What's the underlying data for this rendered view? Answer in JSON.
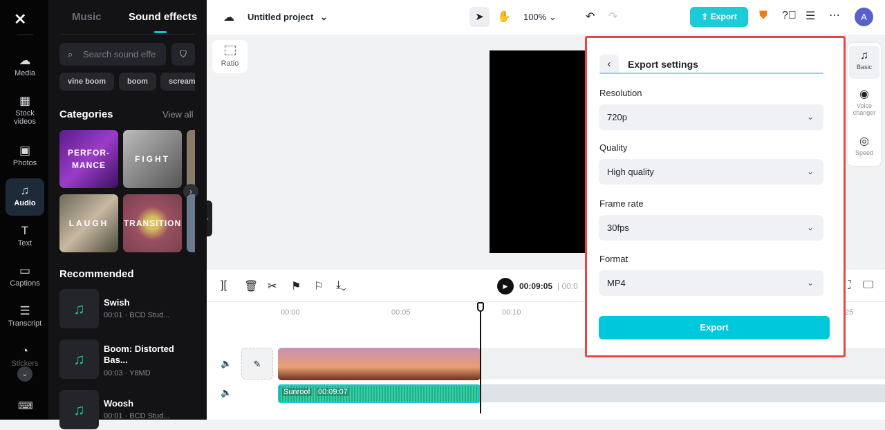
{
  "rail": {
    "items": [
      {
        "label": "Media",
        "icon": "cloud-upload-icon"
      },
      {
        "label": "Stock videos",
        "icon": "film-icon"
      },
      {
        "label": "Photos",
        "icon": "image-icon"
      },
      {
        "label": "Audio",
        "icon": "music-icon",
        "active": true
      },
      {
        "label": "Text",
        "icon": "text-icon"
      },
      {
        "label": "Captions",
        "icon": "captions-icon"
      },
      {
        "label": "Transcript",
        "icon": "transcript-icon"
      },
      {
        "label": "Stickers",
        "icon": "sticker-icon"
      }
    ]
  },
  "panel": {
    "tabs": [
      "Music",
      "Sound effects"
    ],
    "active_tab": "Sound effects",
    "search_placeholder": "Search sound effe",
    "chips": [
      "vine boom",
      "boom",
      "scream"
    ],
    "categories_title": "Categories",
    "view_all": "View all",
    "categories": [
      "PERFOR-\nMANCE",
      "FIGHT",
      "LAUGH",
      "TRANSITION"
    ],
    "recommended_title": "Recommended",
    "recommended": [
      {
        "title": "Swish",
        "meta": "00:01 · BCD Stud..."
      },
      {
        "title": "Boom: Distorted Bas...",
        "meta": "00:03 · Y8MD"
      },
      {
        "title": "Woosh",
        "meta": "00:01 · BCD Stud..."
      }
    ]
  },
  "top": {
    "project": "Untitled project",
    "zoom": "100%",
    "export": "Export",
    "avatar": "A"
  },
  "preview": {
    "ratio": "Ratio"
  },
  "timeline": {
    "current": "00:09:05",
    "total": "00:0",
    "ticks": [
      "00:00",
      "00:05",
      "00:10",
      "25"
    ],
    "audio_clip": "Sunroof",
    "audio_duration": "00:09:07"
  },
  "export_settings": {
    "title": "Export settings",
    "fields": [
      {
        "label": "Resolution",
        "value": "720p"
      },
      {
        "label": "Quality",
        "value": "High quality"
      },
      {
        "label": "Frame rate",
        "value": "30fps"
      },
      {
        "label": "Format",
        "value": "MP4"
      }
    ],
    "button": "Export"
  },
  "side": {
    "items": [
      "Basic",
      "Voice changer",
      "Speed"
    ]
  },
  "colors": {
    "accent": "#00c8dc",
    "highlight": "#e84646",
    "audio": "#1db38a"
  }
}
